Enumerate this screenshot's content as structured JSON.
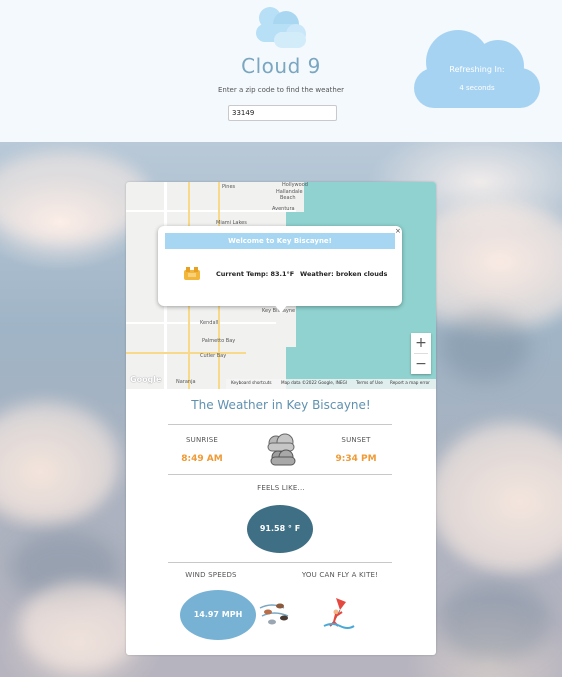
{
  "header": {
    "title": "Cloud 9",
    "subtitle": "Enter a zip code to find the weather",
    "zip_value": "33149",
    "refresh_label": "Refreshing In:",
    "refresh_count": "4 seconds",
    "logo_icon": "cloud-icon"
  },
  "map": {
    "popup": {
      "title": "Welcome to Key Biscayne!",
      "current_temp": "Current Temp: 83.1°F",
      "weather": "Weather: broken clouds",
      "close": "×",
      "icon": "broken-clouds-icon"
    },
    "labels": {
      "pines": "Pines",
      "hollywood": "Hollywood",
      "hallandale": "Hallandale",
      "beach": "Beach",
      "aventura": "Aventura",
      "miami_lakes": "Miami Lakes",
      "key_biscayne": "Key Biscayne",
      "kendall": "Kendall",
      "palmetto_bay": "Palmetto Bay",
      "cutler_bay": "Cutler Bay",
      "naranja": "Naranja"
    },
    "zoom_in": "+",
    "zoom_out": "−",
    "google_logo": "Google",
    "attribution": {
      "shortcuts": "Keyboard shortcuts",
      "data": "Map data ©2022 Google, INEGI",
      "terms": "Terms of Use",
      "report": "Report a map error"
    }
  },
  "weather": {
    "heading": "The Weather in Key Biscayne!",
    "sunrise_label": "SUNRISE",
    "sunrise_time": "8:49 AM",
    "sunset_label": "SUNSET",
    "sunset_time": "9:34 PM",
    "feels_label": "FEELS LIKE...",
    "feels_value": "91.58 ° F",
    "wind_label": "WIND SPEEDS",
    "wind_value": "14.97 MPH",
    "kite_label": "YOU CAN FLY A KITE!",
    "condition_icon": "clouds-icon",
    "wind_icon": "wind-icon",
    "kite_icon": "kite-icon"
  },
  "colors": {
    "title": "#7aa6c0",
    "banner": "#a6d6f1",
    "feels_circle": "#3e6f85",
    "wind_circle": "#77b2d4",
    "time_text": "#ef9a35",
    "refresh_cloud": "#a7d3f3"
  }
}
